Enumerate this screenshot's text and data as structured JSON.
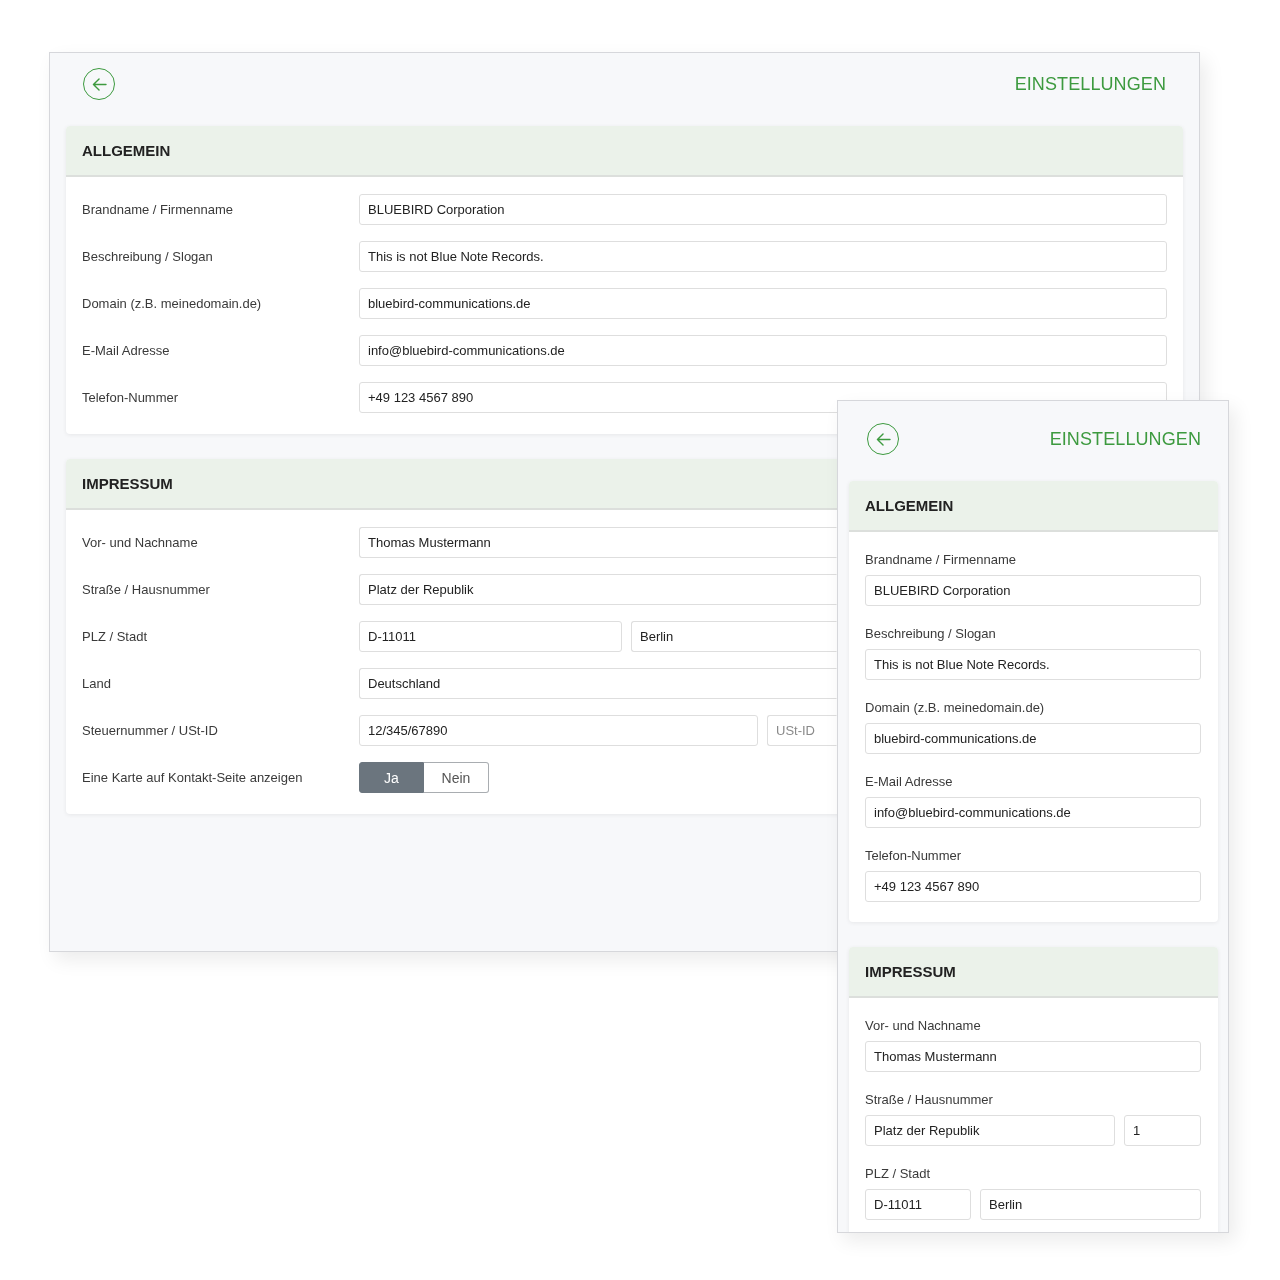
{
  "windows": [
    {
      "kind": "desktop",
      "title": "EINSTELLUNGEN",
      "sections": [
        {
          "title": "ALLGEMEIN",
          "fields": [
            {
              "kind": "text",
              "label": "Brandname / Firmenname",
              "inputs": [
                {
                  "value": "BLUEBIRD Corporation"
                }
              ]
            },
            {
              "kind": "text",
              "label": "Beschreibung / Slogan",
              "inputs": [
                {
                  "value": "This is not Blue Note Records."
                }
              ]
            },
            {
              "kind": "text",
              "label": "Domain (z.B. meinedomain.de)",
              "inputs": [
                {
                  "value": "bluebird-communications.de"
                }
              ]
            },
            {
              "kind": "text",
              "label": "E-Mail Adresse",
              "inputs": [
                {
                  "value": "info@bluebird-communications.de"
                }
              ]
            },
            {
              "kind": "text",
              "label": "Telefon-Nummer",
              "inputs": [
                {
                  "value": "+49 123 4567 890"
                }
              ]
            }
          ]
        },
        {
          "title": "IMPRESSUM",
          "fields": [
            {
              "kind": "text",
              "label": "Vor- und Nachname",
              "inputs": [
                {
                  "value": "Thomas Mustermann"
                }
              ]
            },
            {
              "kind": "text",
              "label": "Straße / Hausnummer",
              "inputs": [
                {
                  "value": "Platz der Republik"
                }
              ]
            },
            {
              "kind": "city",
              "label": "PLZ / Stadt",
              "inputs": [
                {
                  "value": "D-11011"
                },
                {
                  "value": "Berlin"
                }
              ]
            },
            {
              "kind": "text",
              "label": "Land",
              "inputs": [
                {
                  "value": "Deutschland"
                }
              ]
            },
            {
              "kind": "tax",
              "label": "Steuernummer / USt-ID",
              "inputs": [
                {
                  "value": "12/345/67890"
                },
                {
                  "placeholder": "USt-ID"
                }
              ]
            },
            {
              "kind": "toggle",
              "label": "Eine Karte auf Kontakt-Seite anzeigen",
              "options": [
                {
                  "label": "Ja",
                  "selected": true
                },
                {
                  "label": "Nein",
                  "selected": false
                }
              ]
            }
          ]
        }
      ]
    },
    {
      "kind": "mobile",
      "title": "EINSTELLUNGEN",
      "sections": [
        {
          "title": "ALLGEMEIN",
          "fields": [
            {
              "kind": "text",
              "label": "Brandname / Firmenname",
              "inputs": [
                {
                  "value": "BLUEBIRD Corporation"
                }
              ]
            },
            {
              "kind": "text",
              "label": "Beschreibung / Slogan",
              "inputs": [
                {
                  "value": "This is not Blue Note Records."
                }
              ]
            },
            {
              "kind": "text",
              "label": "Domain (z.B. meinedomain.de)",
              "inputs": [
                {
                  "value": "bluebird-communications.de"
                }
              ]
            },
            {
              "kind": "text",
              "label": "E-Mail Adresse",
              "inputs": [
                {
                  "value": "info@bluebird-communications.de"
                }
              ]
            },
            {
              "kind": "text",
              "label": "Telefon-Nummer",
              "inputs": [
                {
                  "value": "+49 123 4567 890"
                }
              ]
            }
          ]
        },
        {
          "title": "IMPRESSUM",
          "fields": [
            {
              "kind": "text",
              "label": "Vor- und Nachname",
              "inputs": [
                {
                  "value": "Thomas Mustermann"
                }
              ]
            },
            {
              "kind": "street",
              "label": "Straße / Hausnummer",
              "inputs": [
                {
                  "value": "Platz der Republik"
                },
                {
                  "value": "1"
                }
              ]
            },
            {
              "kind": "city",
              "label": "PLZ / Stadt",
              "inputs": [
                {
                  "value": "D-11011"
                },
                {
                  "value": "Berlin"
                }
              ]
            }
          ]
        }
      ]
    }
  ]
}
